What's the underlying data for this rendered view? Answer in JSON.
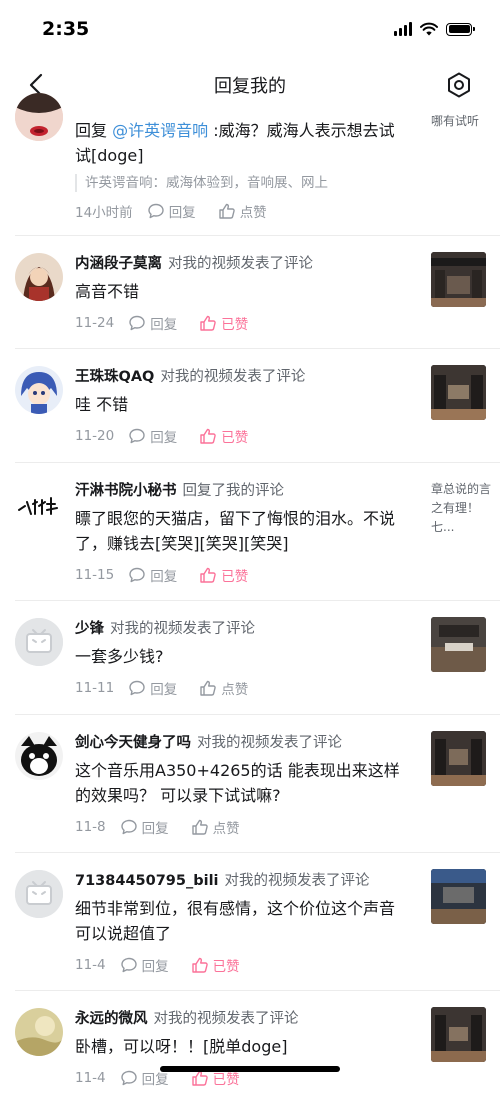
{
  "status": {
    "time": "2:35"
  },
  "nav": {
    "title": "回复我的"
  },
  "reply_label": "回复",
  "like_label": "点赞",
  "liked_label": "已赞",
  "top": {
    "prefix": "回复 ",
    "mention": "@许英谔音响",
    "text": " :威海？威海人表示想去试试[doge]",
    "quote": "许英谔音响：威海体验到，音响展、网上",
    "date": "14小时前",
    "side_text": "哪有试听"
  },
  "items": [
    {
      "user": "内涵段子莫离",
      "action": "对我的视频发表了评论",
      "text": "高音不错",
      "date": "11-24",
      "liked": true,
      "thumb": true,
      "side_text": ""
    },
    {
      "user": "王珠珠QAQ",
      "action": "对我的视频发表了评论",
      "text": "哇 不错",
      "date": "11-20",
      "liked": true,
      "thumb": true,
      "side_text": ""
    },
    {
      "user": "汗淋书院小秘书",
      "action": "回复了我的评论",
      "text": "瞟了眼您的天猫店，留下了悔恨的泪水。不说了，赚钱去[笑哭][笑哭][笑哭]",
      "date": "11-15",
      "liked": true,
      "thumb": false,
      "side_text": "章总说的言之有理！七..."
    },
    {
      "user": "少锋",
      "action": "对我的视频发表了评论",
      "text": "一套多少钱?",
      "date": "11-11",
      "liked": false,
      "thumb": true,
      "side_text": ""
    },
    {
      "user": "剑心今天健身了吗",
      "action": "对我的视频发表了评论",
      "text": "这个音乐用A350+4265的话 能表现出来这样的效果吗？ 可以录下试试嘛?",
      "date": "11-8",
      "liked": false,
      "thumb": true,
      "side_text": ""
    },
    {
      "user": "71384450795_bili",
      "action": "对我的视频发表了评论",
      "text": "细节非常到位，很有感情，这个价位这个声音可以说超值了",
      "date": "11-4",
      "liked": true,
      "thumb": true,
      "side_text": ""
    },
    {
      "user": "永远的微风",
      "action": "对我的视频发表了评论",
      "text": "卧槽，可以呀！！[脱单doge]",
      "date": "11-4",
      "liked": true,
      "thumb": true,
      "side_text": ""
    }
  ],
  "avatar_logo_text": "小秘书",
  "colors": {
    "accent_pink": "#fb7299",
    "link_blue": "#3e8fd8",
    "meta_gray": "#9499a0"
  }
}
